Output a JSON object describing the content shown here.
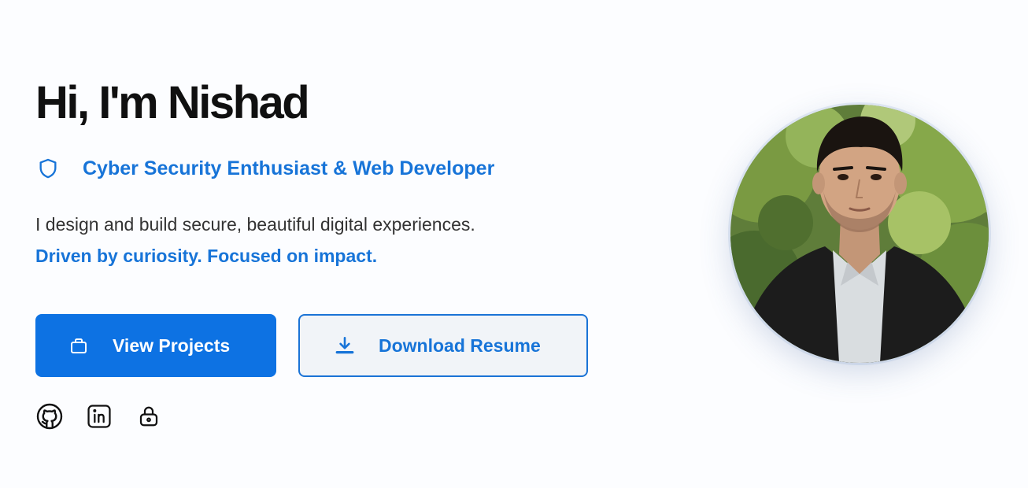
{
  "hero": {
    "title": "Hi, I'm Nishad",
    "role": "Cyber Security Enthusiast & Web Developer",
    "description": "I design and build secure, beautiful digital experiences.",
    "tagline": "Driven by curiosity. Focused on impact."
  },
  "buttons": {
    "primary": {
      "label": "View Projects",
      "icon": "briefcase-icon"
    },
    "secondary": {
      "label": "Download Resume",
      "icon": "download-icon"
    }
  },
  "socials": [
    {
      "name": "github",
      "icon": "github-icon"
    },
    {
      "name": "linkedin",
      "icon": "linkedin-icon"
    },
    {
      "name": "security",
      "icon": "lock-icon"
    }
  ],
  "profile": {
    "image": "profile-photo"
  },
  "colors": {
    "accent": "#1774d8",
    "primary_button": "#0d72e3",
    "heading": "#101010",
    "body_text": "#333333",
    "background": "#fcfdff"
  }
}
